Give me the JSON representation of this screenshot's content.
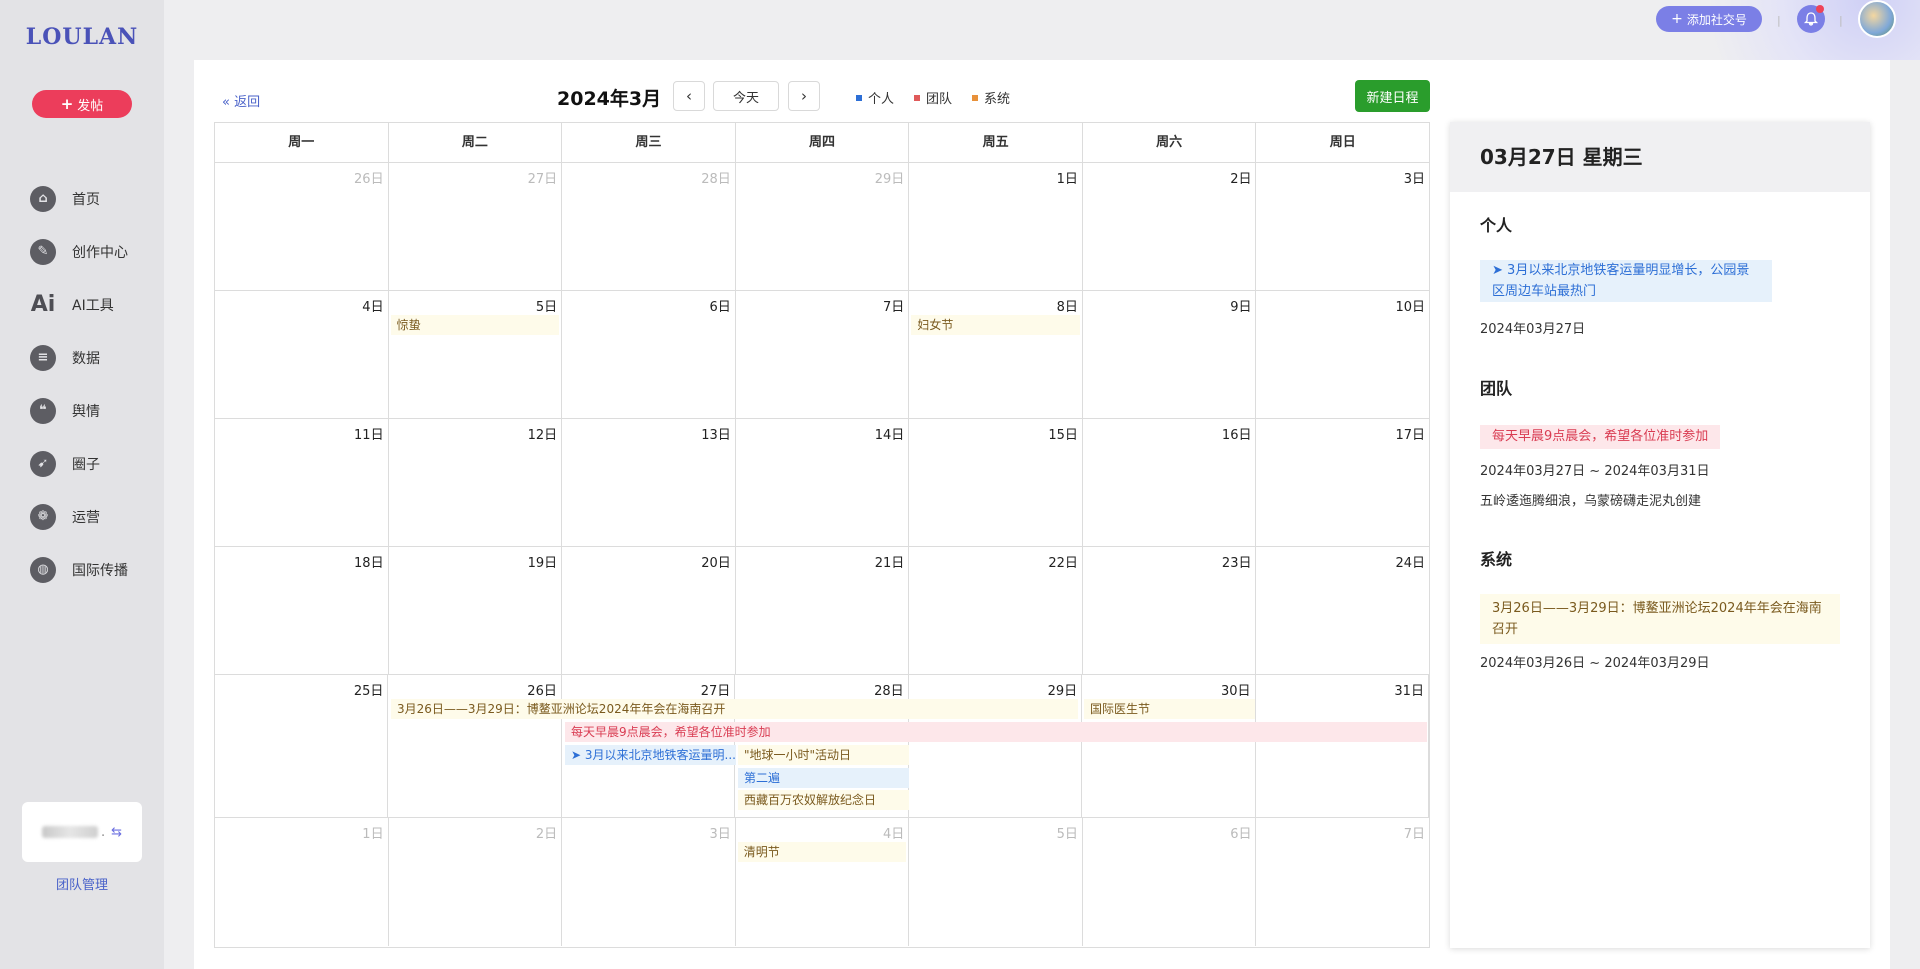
{
  "app": {
    "logo": "LOULAN",
    "post_button": "发帖"
  },
  "sidebar": {
    "items": [
      {
        "label": "首页",
        "icon": "home-icon",
        "glyph": "⌂"
      },
      {
        "label": "创作中心",
        "icon": "palette-icon",
        "glyph": "✎"
      },
      {
        "label": "AI工具",
        "icon": "ai-icon",
        "glyph": "Ai"
      },
      {
        "label": "数据",
        "icon": "database-icon",
        "glyph": "≡"
      },
      {
        "label": "舆情",
        "icon": "quote-icon",
        "glyph": "❝"
      },
      {
        "label": "圈子",
        "icon": "compass-icon",
        "glyph": "➹"
      },
      {
        "label": "运营",
        "icon": "operation-icon",
        "glyph": "❁"
      },
      {
        "label": "国际传播",
        "icon": "globe-icon",
        "glyph": "◍"
      }
    ],
    "team_dots": ".",
    "team_manage": "团队管理"
  },
  "topbar": {
    "add_social": "添加社交号",
    "separator": "|"
  },
  "calendar": {
    "back": "返回",
    "month_title": "2024年3月",
    "today": "今天",
    "new_event": "新建日程",
    "legend": [
      {
        "label": "个人",
        "color": "#2d6fd6"
      },
      {
        "label": "团队",
        "color": "#e05a5a"
      },
      {
        "label": "系统",
        "color": "#e8913a"
      }
    ],
    "weekdays": [
      "周一",
      "周二",
      "周三",
      "周四",
      "周五",
      "周六",
      "周日"
    ],
    "weeks": [
      [
        "26日",
        "27日",
        "28日",
        "29日",
        "1日",
        "2日",
        "3日"
      ],
      [
        "4日",
        "5日",
        "6日",
        "7日",
        "8日",
        "9日",
        "10日"
      ],
      [
        "11日",
        "12日",
        "13日",
        "14日",
        "15日",
        "16日",
        "17日"
      ],
      [
        "18日",
        "19日",
        "20日",
        "21日",
        "22日",
        "23日",
        "24日"
      ],
      [
        "25日",
        "26日",
        "27日",
        "28日",
        "29日",
        "30日",
        "31日"
      ],
      [
        "1日",
        "2日",
        "3日",
        "4日",
        "5日",
        "6日",
        "7日"
      ]
    ],
    "events": {
      "jingzhe": "惊蛰",
      "womens_day": "妇女节",
      "boao": "3月26日——3月29日：博鳌亚洲论坛2024年年会在海南召开",
      "doctors_day": "国际医生节",
      "morning_meeting": "每天早晨9点晨会，希望各位准时参加",
      "subway": "3月以来北京地铁客运量明...",
      "earth_hour": "\"地球一小时\"活动日",
      "second_week": "第二遍",
      "tibet": "西藏百万农奴解放纪念日",
      "qingming": "清明节"
    }
  },
  "detail": {
    "date_title": "03月27日 星期三",
    "personal": {
      "title": "个人",
      "text": "3月以来北京地铁客运量明显增长，公园景区周边车站最热门",
      "date": "2024年03月27日"
    },
    "team": {
      "title": "团队",
      "text": "每天早晨9点晨会，希望各位准时参加",
      "date": "2024年03月27日 ~ 2024年03月31日",
      "note": "五岭逶迤腾细浪，乌蒙磅礴走泥丸创建"
    },
    "system": {
      "title": "系统",
      "text": "3月26日——3月29日：博鳌亚洲论坛2024年年会在海南召开",
      "date": "2024年03月26日 ~ 2024年03月29日"
    }
  }
}
